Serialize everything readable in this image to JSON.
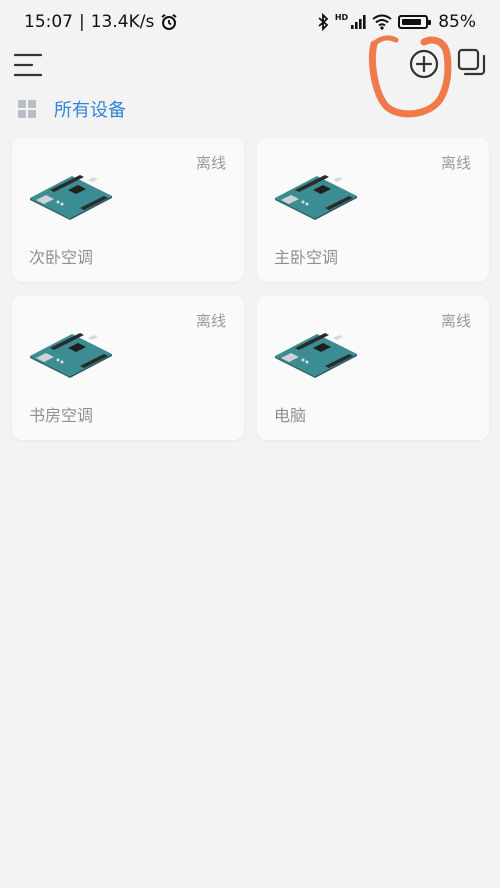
{
  "status_bar": {
    "time": "15:07",
    "network_speed": "13.4K/s",
    "signal_label": "HD",
    "battery_percent": "85%",
    "battery_level": 0.85
  },
  "toolbar": {
    "menu_icon": "menu-icon",
    "add_icon": "add-circle-icon",
    "copy_icon": "copy-icon",
    "annotation_color": "#f07a4a"
  },
  "section": {
    "title": "所有设备",
    "title_color": "#2f86d6"
  },
  "devices": [
    {
      "name": "次卧空调",
      "status": "离线"
    },
    {
      "name": "主卧空调",
      "status": "离线"
    },
    {
      "name": "书房空调",
      "status": "离线"
    },
    {
      "name": "电脑",
      "status": "离线"
    }
  ]
}
